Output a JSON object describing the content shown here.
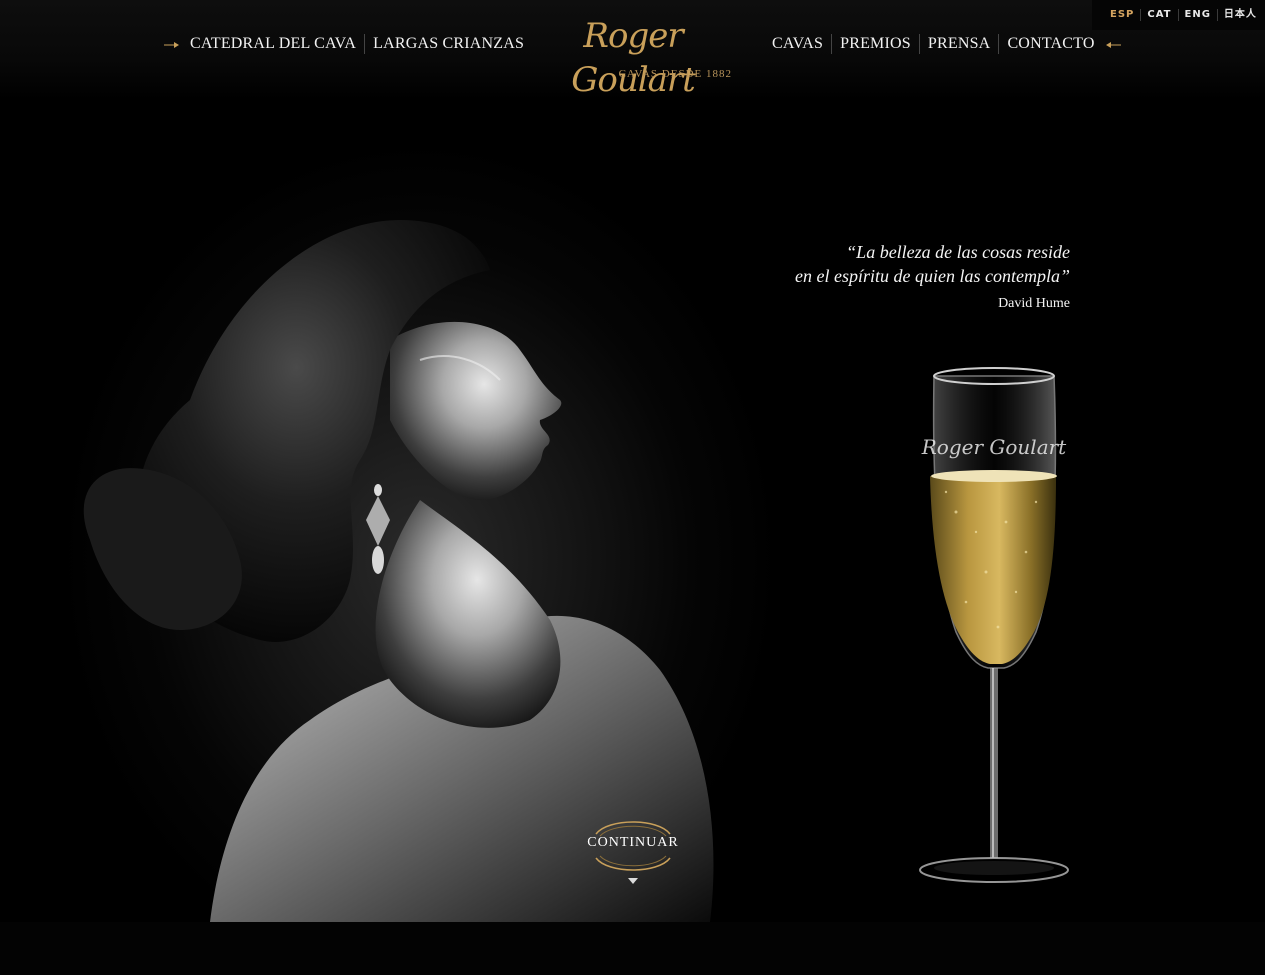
{
  "header": {
    "nav_left": [
      "CATEDRAL DEL CAVA",
      "LARGAS CRIANZAS"
    ],
    "nav_right": [
      "CAVAS",
      "PREMIOS",
      "PRENSA",
      "CONTACTO"
    ],
    "logo": {
      "script": "Roger Goulart",
      "tagline": "CAVAS DESDE 1882"
    },
    "languages": [
      {
        "label": "ESP",
        "active": true
      },
      {
        "label": "CAT",
        "active": false
      },
      {
        "label": "ENG",
        "active": false
      },
      {
        "label": "日本人",
        "active": false
      }
    ]
  },
  "quote": {
    "line1": "“La belleza de las cosas reside",
    "line2": "en el espíritu de quien las contempla”",
    "author": "David Hume"
  },
  "glass": {
    "etching": "Roger Goulart"
  },
  "cta": {
    "label": "CONTINUAR"
  },
  "colors": {
    "gold": "#c9a05a",
    "background": "#000000",
    "active_language": "#d4a460"
  }
}
